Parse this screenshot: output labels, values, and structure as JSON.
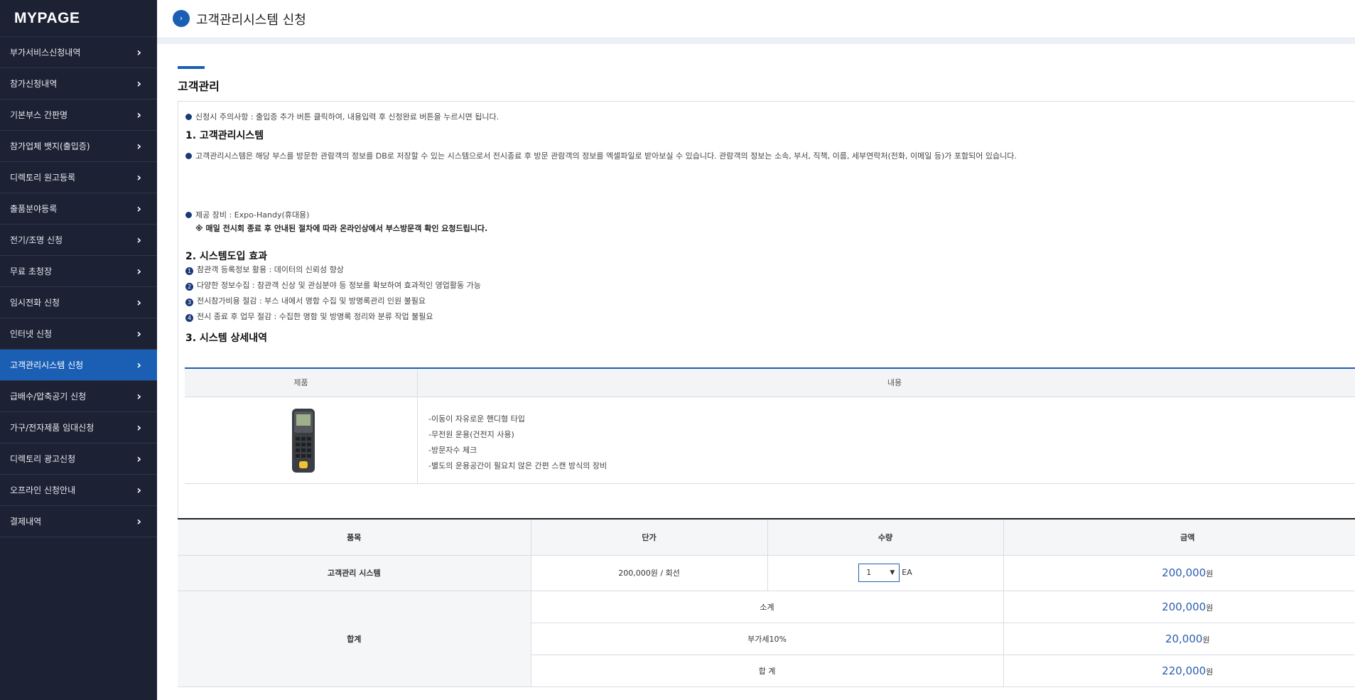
{
  "sidebar": {
    "title": "MYPAGE",
    "items": [
      {
        "label": "부가서비스신청내역",
        "active": false
      },
      {
        "label": "참가신청내역",
        "active": false
      },
      {
        "label": "기본부스 간판명",
        "active": false
      },
      {
        "label": "참가업체 뱃지(출입증)",
        "active": false
      },
      {
        "label": "디렉토리 원고등록",
        "active": false
      },
      {
        "label": "출품분야등록",
        "active": false
      },
      {
        "label": "전기/조명 신청",
        "active": false
      },
      {
        "label": "무료 초청장",
        "active": false
      },
      {
        "label": "임시전화 신청",
        "active": false
      },
      {
        "label": "인터넷 신청",
        "active": false
      },
      {
        "label": "고객관리시스템 신청",
        "active": true
      },
      {
        "label": "급배수/압축공기 신청",
        "active": false
      },
      {
        "label": "가구/전자제품 임대신청",
        "active": false
      },
      {
        "label": "디렉토리 광고신청",
        "active": false
      },
      {
        "label": "오프라인 신청안내",
        "active": false
      },
      {
        "label": "결제내역",
        "active": false
      }
    ]
  },
  "header": {
    "title": "고객관리시스템 신청"
  },
  "section": {
    "title": "고객관리",
    "notice": "신청시 주의사항 : 출입증 추가 버튼 클릭하여, 내용입력 후 신청완료 버튼을 누르시면 됩니다.",
    "h1": "1. 고객관리시스템",
    "desc": "고객관리시스템은 해당 부스를 방문한 관람객의 정보를 DB로 저장할 수 있는 시스템으로서 전시종료 후 방문 관람객의 정보를 엑셀파일로 받아보실 수 있습니다. 관람객의 정보는 소속, 부서, 직책, 이름, 세부연락처(전화, 이메일 등)가 포함되어 있습니다.",
    "equip": "제공 장비 : Expo-Handy(휴대용)",
    "equip_note": "※ 매일 전시회 종료 후 안내된 절차에 따라 온라인상에서 부스방문객 확인 요청드립니다.",
    "h2": "2. 시스템도입 효과",
    "effects": [
      {
        "num": "1",
        "text": "참관객 등록정보 활용 : 데이터의 신뢰성 향상"
      },
      {
        "num": "2",
        "text": "다양한 정보수집 : 참관객 신상 및 관심분야 등 정보를 확보하여 효과적인 영업활동 가능"
      },
      {
        "num": "3",
        "text": "전시참가비용 절감 : 부스 내에서 명함 수집 및 방명록관리 인원 불필요"
      },
      {
        "num": "4",
        "text": "전시 종료 후 업무 절감 : 수집한 명함 및 방명록 정리와 분류 작업 불필요"
      }
    ],
    "h3": "3. 시스템 상세내역"
  },
  "equipment_table": {
    "col_product": "제품",
    "col_content": "내용",
    "lines": [
      "-이동이 자유로운 핸디형 타입",
      "-무전원 운용(건전지 사용)",
      "-방문자수 체크",
      "-별도의 운용공간이 필요치 않은 간편 스캔 방식의 장비"
    ]
  },
  "order_table": {
    "headers": {
      "item": "품목",
      "unit_price": "단가",
      "qty": "수량",
      "amount": "금액"
    },
    "row": {
      "item": "고객관리 시스템",
      "unit_price": "200,000원 / 회선",
      "qty": "1",
      "qty_unit": "EA",
      "amount_num": "200,000",
      "won": "원"
    },
    "total_label": "합계",
    "subtotal_label": "소계",
    "subtotal": "200,000",
    "vat_label": "부가세10%",
    "vat": "20,000",
    "grand_label": "합 계",
    "grand": "220,000",
    "won": "원"
  },
  "colors": {
    "sidebar_bg": "#1c2234",
    "accent": "#1a5fb4",
    "price": "#2a5db0"
  }
}
